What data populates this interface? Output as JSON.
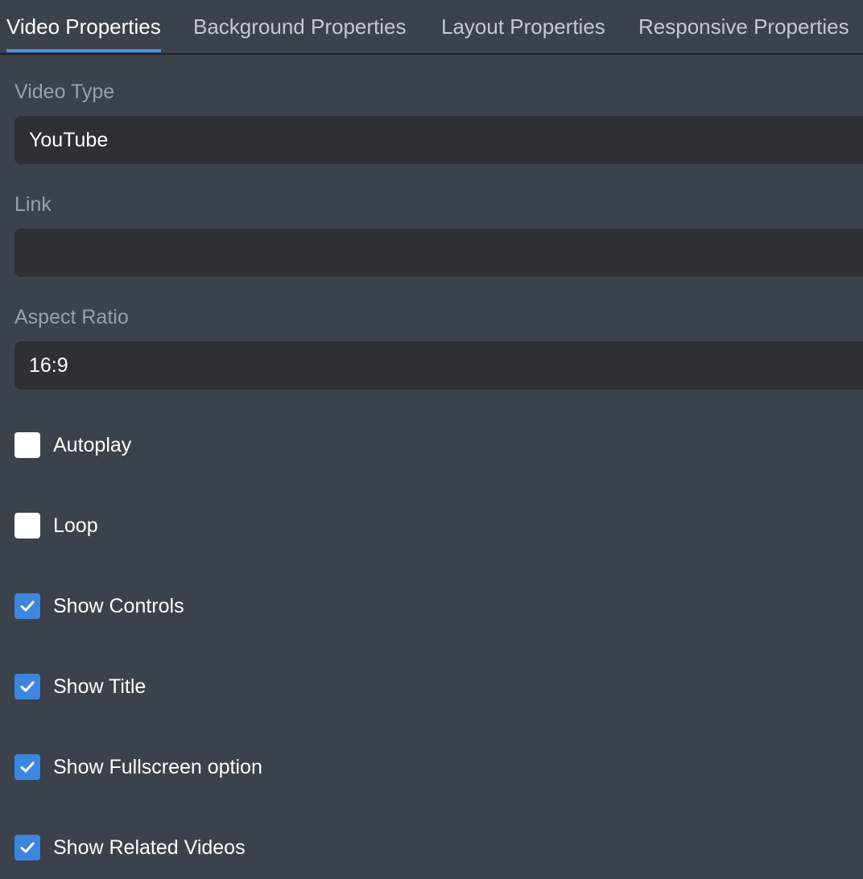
{
  "tabs": [
    {
      "label": "Video Properties",
      "active": true
    },
    {
      "label": "Background Properties",
      "active": false
    },
    {
      "label": "Layout Properties",
      "active": false
    },
    {
      "label": "Responsive Properties",
      "active": false
    }
  ],
  "fields": {
    "video_type": {
      "label": "Video Type",
      "value": "YouTube"
    },
    "link": {
      "label": "Link",
      "value": "",
      "placeholder": ""
    },
    "aspect_ratio": {
      "label": "Aspect Ratio",
      "value": "16:9"
    }
  },
  "options": [
    {
      "label": "Autoplay",
      "checked": false
    },
    {
      "label": "Loop",
      "checked": false
    },
    {
      "label": "Show Controls",
      "checked": true
    },
    {
      "label": "Show Title",
      "checked": true
    },
    {
      "label": "Show Fullscreen option",
      "checked": true
    },
    {
      "label": "Show Related Videos",
      "checked": true
    }
  ],
  "colors": {
    "background": "#3c424c",
    "input_background": "#2e3035",
    "accent": "#4a90e2",
    "checkbox_checked": "#3d86e0"
  },
  "icons": {
    "checkmark": "checkmark-icon"
  }
}
